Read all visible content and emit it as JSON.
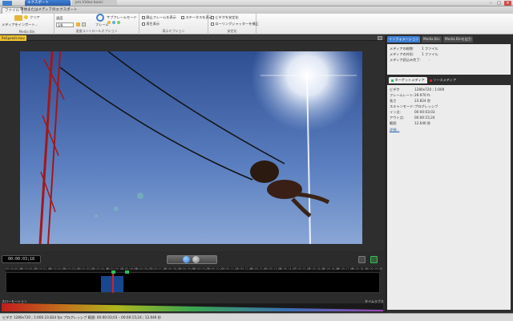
{
  "window": {
    "tabs": [
      {
        "label": "エクスポート"
      },
      {
        "label": "pm.Video-basic"
      }
    ],
    "controls": [
      "–",
      "□",
      "✕"
    ]
  },
  "ribbon_tabs": [
    {
      "label": "ファイル"
    },
    {
      "label": "単体またはメディアのエクスポート"
    }
  ],
  "ribbon": {
    "media_bin": {
      "add_label": "メディアをインポート...",
      "clear_label": "クリア",
      "group_label": "Media Bin"
    },
    "playback": {
      "speed_label": "速度",
      "speed_value": "1/8",
      "frame_label": "フレーム",
      "sub_label": "サブフレームモード",
      "group_label": "速度コントロールオプション",
      "options": [
        "フレームを保持"
      ]
    },
    "display": {
      "still_frame_label": "静止フレームを表示",
      "status_label": "ステータスを表示",
      "playback_display_label": "再生表示",
      "group_label": "表示オプション"
    },
    "stabilize": {
      "video_label": "ビデオを安定化",
      "rolling_shutter_label": "ローリングシャッターを補正",
      "group_label": "安定化"
    }
  },
  "document": {
    "tab_label": "ReSpeedr.mov"
  },
  "transport": {
    "timecode": "00:00:03;18"
  },
  "timeline": {
    "ticks": [
      "00:00:00;00",
      "00:00:00;23",
      "00:00:01;16",
      "00:00:02;09",
      "00:00:03;02",
      "00:00:03;25",
      "00:00:04;18",
      "00:00:05;11",
      "00:00:06;04",
      "00:00:06;27",
      "00:00:07;20",
      "00:00:08;13",
      "00:00:09;06",
      "00:00:09;29",
      "00:00:10;22",
      "00:00:11;15",
      "00:00:12;08",
      "00:00:13;01",
      "00:00:13;24",
      "00:00:14;17",
      "00:00:15;10",
      "00:00:16;03",
      "00:00:16;26",
      "00:00:17;19",
      "00:00:18;12",
      "00:00:19;05"
    ],
    "slowmo_label": "スローモーション",
    "timelapse_label": "タイムラプス"
  },
  "status": {
    "text": "ビデオ 1280x720 ; 1:000  23.824 fps  プログレッシブ  範囲: 00:00:03;03 – 00:00:15;24 ; 12.646 秒"
  },
  "right_panel": {
    "tabs": [
      {
        "label": "インフォメーション"
      },
      {
        "label": "Media Bin"
      },
      {
        "label": "Media Binを出力"
      }
    ],
    "info": [
      {
        "key": "メディアの総数:",
        "value": "1 ファイル"
      },
      {
        "key": "メディアの外形:",
        "value": "1 ファイル"
      },
      {
        "key": "メディア読込み完了:",
        "value": "-"
      }
    ],
    "sub_tabs": [
      {
        "label": "ターゲットメディア"
      },
      {
        "label": "ソースメディア"
      }
    ],
    "media_props": [
      {
        "key": "ビデオ",
        "value": "1280x720 ; 1:000"
      },
      {
        "key": "フレームレート:",
        "value": "29.970 fs"
      },
      {
        "key": "長さ",
        "value": "23.824 秒"
      },
      {
        "key": "スキャンモード:",
        "value": "プログレッシブ"
      },
      {
        "key": "イン点:",
        "value": "00:00:03;03"
      },
      {
        "key": "アウト点:",
        "value": "00:00:15;24"
      },
      {
        "key": "範囲",
        "value": "12.646 秒"
      }
    ],
    "more_link": "詳細..."
  },
  "colors": {
    "accent": "#3f7fd2",
    "sky": "#5b7fc0",
    "document_tab": "#f1c232",
    "selection_marker": "#2bbf5a",
    "speed_red": "#e01d1d"
  }
}
